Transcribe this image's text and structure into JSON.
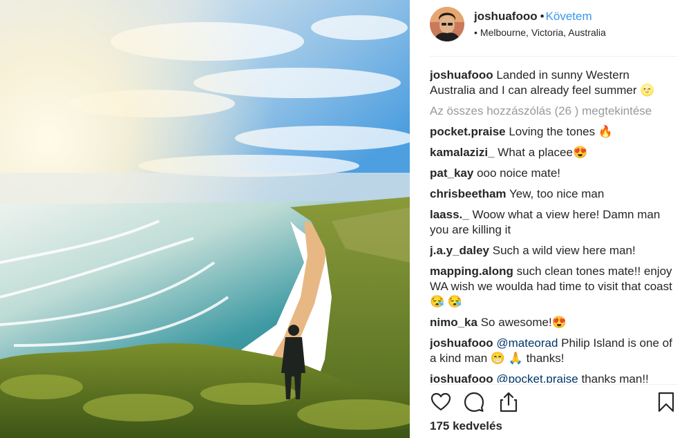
{
  "post": {
    "username": "joshuafooo",
    "dot": "•",
    "follow_label": "Követem",
    "location_bullet": "•",
    "location": "Melbourne, Victoria, Australia"
  },
  "caption": {
    "user": "joshuafooo",
    "text": "Landed in sunny Western Australia and I can already feel summer 🌝"
  },
  "view_all": "Az összes hozzászólás (26 ) megtekintése",
  "comments": [
    {
      "user": "pocket.praise",
      "text": "Loving the tones 🔥"
    },
    {
      "user": "kamalazizi_",
      "text": "What a placee😍"
    },
    {
      "user": "pat_kay",
      "text": "ooo noice mate!"
    },
    {
      "user": "chrisbeetham",
      "text": "Yew, too nice man"
    },
    {
      "user": "laass._",
      "text": "Woow what a view here! Damn man you are killing it"
    },
    {
      "user": "j.a.y_daley",
      "text": "Such a wild view here man!"
    },
    {
      "user": "mapping.along",
      "text": "such clean tones mate!! enjoy WA wish we woulda had time to visit that coast 😪 😪"
    },
    {
      "user": "nimo_ka",
      "text": "So awesome!😍"
    },
    {
      "user": "joshuafooo",
      "mention": "@mateorad",
      "text": "Philip Island is one of a kind man 😁 🙏  thanks!"
    },
    {
      "user": "joshuafooo",
      "mention": "@pocket.praise",
      "text": "thanks man!!"
    }
  ],
  "actions": {
    "like_icon": "heart-outline-icon",
    "comment_icon": "comment-bubble-icon",
    "share_icon": "share-upload-icon",
    "save_icon": "bookmark-outline-icon"
  },
  "likes": "175 kedvelés",
  "colors": {
    "link_blue": "#3897f0",
    "mention_blue": "#003569",
    "muted_gray": "#999999",
    "text": "#262626",
    "divider": "#efefef"
  }
}
